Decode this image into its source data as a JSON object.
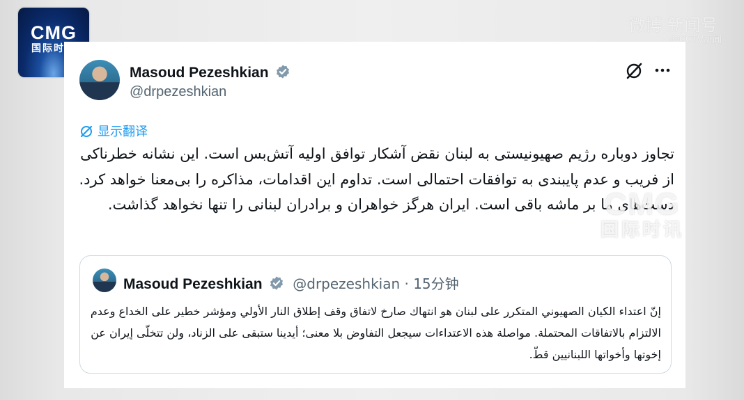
{
  "broadcaster": {
    "logo_text": "CMG",
    "logo_subtext": "国际时讯"
  },
  "watermark": {
    "top_text": "微博 新闻号",
    "top_subtext": "@CCTV新闻",
    "center_text": "CMG",
    "center_subtext": "国际时讯"
  },
  "tweet": {
    "author_name": "Masoud Pezeshkian",
    "author_handle": "@drpezeshkian",
    "translate_label": "显示翻译",
    "text": "تجاوز دوباره رژیم صهیونیستی به لبنان نقض آشکار توافق اولیه آتش‌بس است. این نشانه خطرناکی از فریب و عدم پایبندی به توافقات احتمالی است. تداوم این اقدامات، مذاکره را بی‌معنا خواهد کرد. دست‌های ما بر ماشه باقی است. ایران هرگز خواهران و برادران لبنانی را تنها نخواهد گذاشت."
  },
  "quoted_tweet": {
    "author_name": "Masoud Pezeshkian",
    "meta": "@drpezeshkian · 15分钟",
    "text": "إنّ اعتداء الكيان الصهيوني المتكرر على لبنان هو انتهاك صارخ لاتفاق وقف إطلاق النار الأولي ومؤشر خطير على الخداع وعدم الالتزام بالاتفاقات المحتملة. مواصلة هذه الاعتداءات سيجعل التفاوض بلا معنى؛ أيدينا ستبقى على الزناد، ولن تتخلّى إيران عن إخوتها وأخواتها اللبنانيين قطّ."
  },
  "colors": {
    "verified": "#829aab",
    "link": "#1d9bf0",
    "text": "#0f1419",
    "secondary": "#536471"
  },
  "icons": {
    "verified": "verified-badge-icon",
    "grok": "grok-icon",
    "more": "more-icon",
    "translate": "translate-icon"
  }
}
